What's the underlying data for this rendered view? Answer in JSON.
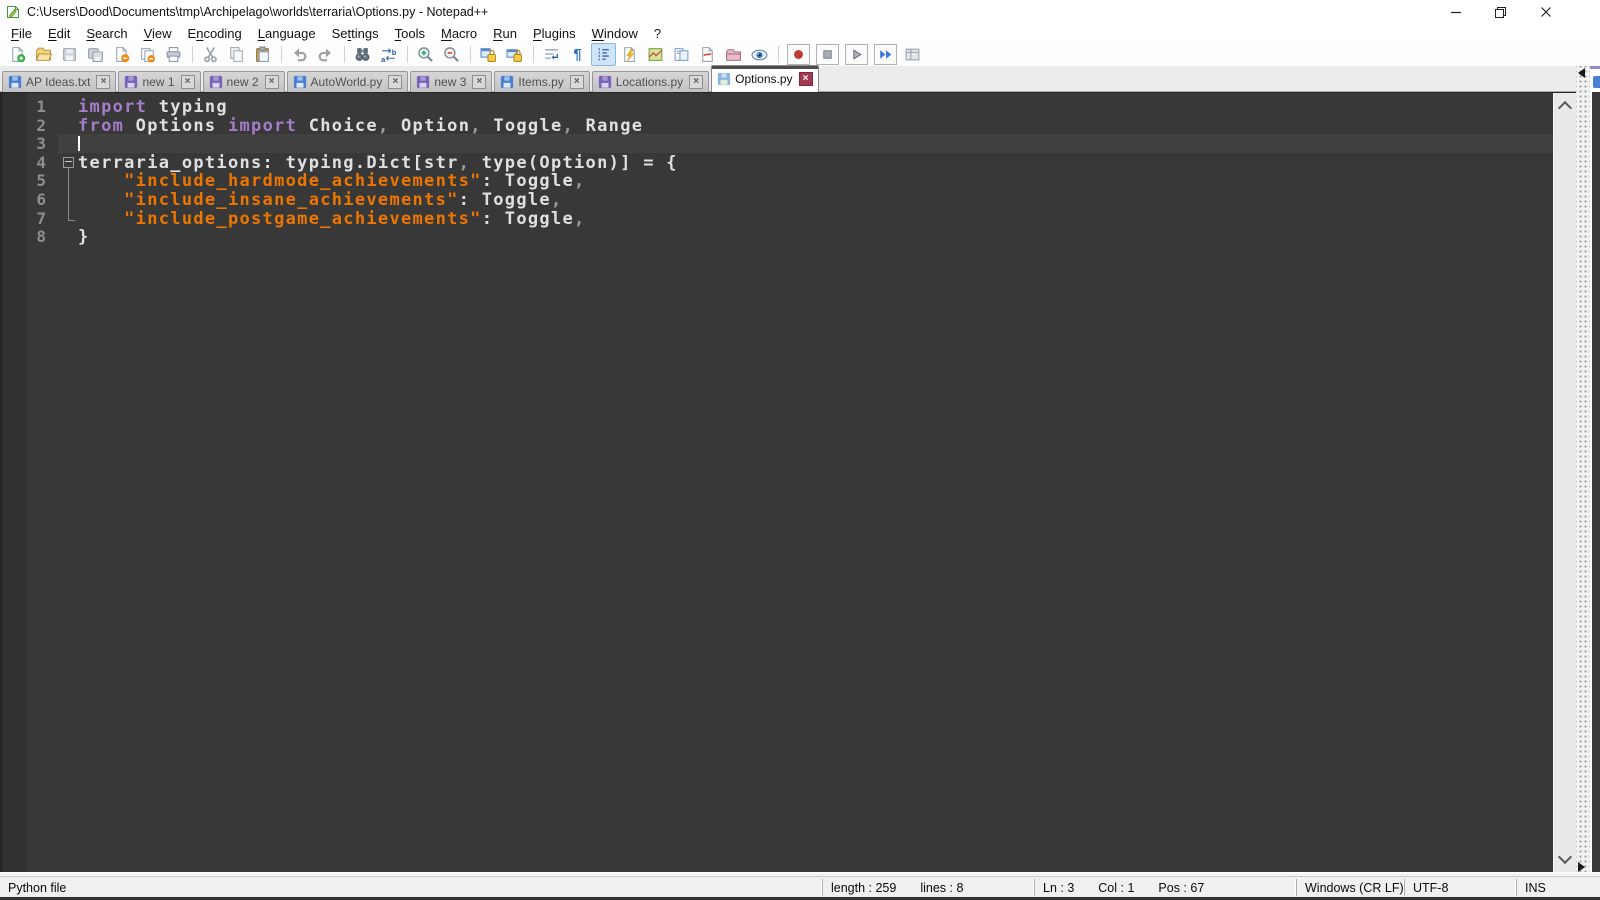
{
  "window": {
    "title": "C:\\Users\\Dood\\Documents\\tmp\\Archipelago\\worlds\\terraria\\Options.py - Notepad++",
    "controls": [
      "minimize",
      "restore",
      "close"
    ]
  },
  "menu": {
    "items": [
      {
        "label": "File",
        "u": 0
      },
      {
        "label": "Edit",
        "u": 0
      },
      {
        "label": "Search",
        "u": 0
      },
      {
        "label": "View",
        "u": 0
      },
      {
        "label": "Encoding",
        "u": 1
      },
      {
        "label": "Language",
        "u": 0
      },
      {
        "label": "Settings",
        "u": 2
      },
      {
        "label": "Tools",
        "u": 0
      },
      {
        "label": "Macro",
        "u": 0
      },
      {
        "label": "Run",
        "u": 0
      },
      {
        "label": "Plugins",
        "u": 0
      },
      {
        "label": "Window",
        "u": 0
      },
      {
        "label": "?",
        "u": -1
      }
    ]
  },
  "toolbar": {
    "items": [
      {
        "name": "new-file"
      },
      {
        "name": "open-file"
      },
      {
        "name": "save",
        "state": "disabled"
      },
      {
        "name": "save-all",
        "state": "disabled"
      },
      {
        "name": "close"
      },
      {
        "name": "close-all"
      },
      {
        "name": "print"
      },
      {
        "name": "separator"
      },
      {
        "name": "cut",
        "state": "disabled"
      },
      {
        "name": "copy",
        "state": "disabled"
      },
      {
        "name": "paste"
      },
      {
        "name": "separator"
      },
      {
        "name": "undo",
        "state": "disabled"
      },
      {
        "name": "redo",
        "state": "disabled"
      },
      {
        "name": "separator"
      },
      {
        "name": "find"
      },
      {
        "name": "replace"
      },
      {
        "name": "separator"
      },
      {
        "name": "zoom-in"
      },
      {
        "name": "zoom-out"
      },
      {
        "name": "separator"
      },
      {
        "name": "sync-vertical-scrolling"
      },
      {
        "name": "sync-horizontal-scrolling"
      },
      {
        "name": "separator"
      },
      {
        "name": "word-wrap"
      },
      {
        "name": "show-all-characters"
      },
      {
        "name": "show-indent-guide",
        "state": "active"
      },
      {
        "name": "function-list"
      },
      {
        "name": "document-map"
      },
      {
        "name": "document-list"
      },
      {
        "name": "file-browser"
      },
      {
        "name": "folder-as-workspace"
      },
      {
        "name": "document-monitor"
      },
      {
        "name": "separator"
      },
      {
        "name": "macro-record",
        "state": "boxed"
      },
      {
        "name": "macro-stop",
        "state": "boxed"
      },
      {
        "name": "macro-play",
        "state": "boxed"
      },
      {
        "name": "macro-run-multiple",
        "state": "boxed"
      },
      {
        "name": "macro-save"
      }
    ]
  },
  "tabs": {
    "items": [
      {
        "label": "AP Ideas.txt",
        "state": "saved",
        "active": false
      },
      {
        "label": "new 1",
        "state": "modified",
        "active": false
      },
      {
        "label": "new 2",
        "state": "modified",
        "active": false
      },
      {
        "label": "AutoWorld.py",
        "state": "saved",
        "active": false
      },
      {
        "label": "new 3",
        "state": "modified",
        "active": false
      },
      {
        "label": "Items.py",
        "state": "saved",
        "active": false
      },
      {
        "label": "Locations.py",
        "state": "modified",
        "active": false
      },
      {
        "label": "Options.py",
        "state": "saved",
        "active": true
      }
    ]
  },
  "editor": {
    "caret": {
      "line": 3,
      "col": 1
    },
    "colors": {
      "bg": "#383838",
      "margin-bg": "#313131",
      "current-line": "#414141",
      "text": "#dee0e2",
      "keyword": "#a47dc8",
      "string": "#ec7600",
      "operator": "#9e9e9e",
      "line-number": "#8e8e8e",
      "caret": "#ffffff",
      "fold": "#8a8a8a"
    },
    "lines": [
      {
        "num": 1,
        "fold": "",
        "segs": [
          {
            "c": "kw",
            "t": "import"
          },
          {
            "c": "id",
            "t": " typing"
          }
        ]
      },
      {
        "num": 2,
        "fold": "",
        "segs": [
          {
            "c": "kw",
            "t": "from"
          },
          {
            "c": "id",
            "t": " Options "
          },
          {
            "c": "kw",
            "t": "import"
          },
          {
            "c": "id",
            "t": " Choice"
          },
          {
            "c": "op",
            "t": ","
          },
          {
            "c": "id",
            "t": " Option"
          },
          {
            "c": "op",
            "t": ","
          },
          {
            "c": "id",
            "t": " Toggle"
          },
          {
            "c": "op",
            "t": ","
          },
          {
            "c": "id",
            "t": " Range"
          }
        ]
      },
      {
        "num": 3,
        "fold": "",
        "segs": []
      },
      {
        "num": 4,
        "fold": "minus",
        "segs": [
          {
            "c": "id",
            "t": "terraria_options: typing.Dict[str"
          },
          {
            "c": "op",
            "t": ","
          },
          {
            "c": "id",
            "t": " type(Option)] = {"
          }
        ]
      },
      {
        "num": 5,
        "fold": "line",
        "segs": [
          {
            "c": "id",
            "t": "    "
          },
          {
            "c": "str",
            "t": "\"include_hardmode_achievements\""
          },
          {
            "c": "id",
            "t": ": Toggle"
          },
          {
            "c": "op",
            "t": ","
          }
        ]
      },
      {
        "num": 6,
        "fold": "line",
        "segs": [
          {
            "c": "id",
            "t": "    "
          },
          {
            "c": "str",
            "t": "\"include_insane_achievements\""
          },
          {
            "c": "id",
            "t": ": Toggle"
          },
          {
            "c": "op",
            "t": ","
          }
        ]
      },
      {
        "num": 7,
        "fold": "corner",
        "segs": [
          {
            "c": "id",
            "t": "    "
          },
          {
            "c": "str",
            "t": "\"include_postgame_achievements\""
          },
          {
            "c": "id",
            "t": ": Toggle"
          },
          {
            "c": "op",
            "t": ","
          }
        ]
      },
      {
        "num": 8,
        "fold": "",
        "segs": [
          {
            "c": "id",
            "t": "}"
          }
        ]
      }
    ]
  },
  "status": {
    "doc_type": "Python file",
    "length_label": "length : 259",
    "lines_label": "lines : 8",
    "ln_label": "Ln : 3",
    "col_label": "Col : 1",
    "pos_label": "Pos : 67",
    "eol_label": "Windows (CR LF)",
    "encoding_label": "UTF-8",
    "insert_mode_label": "INS"
  }
}
